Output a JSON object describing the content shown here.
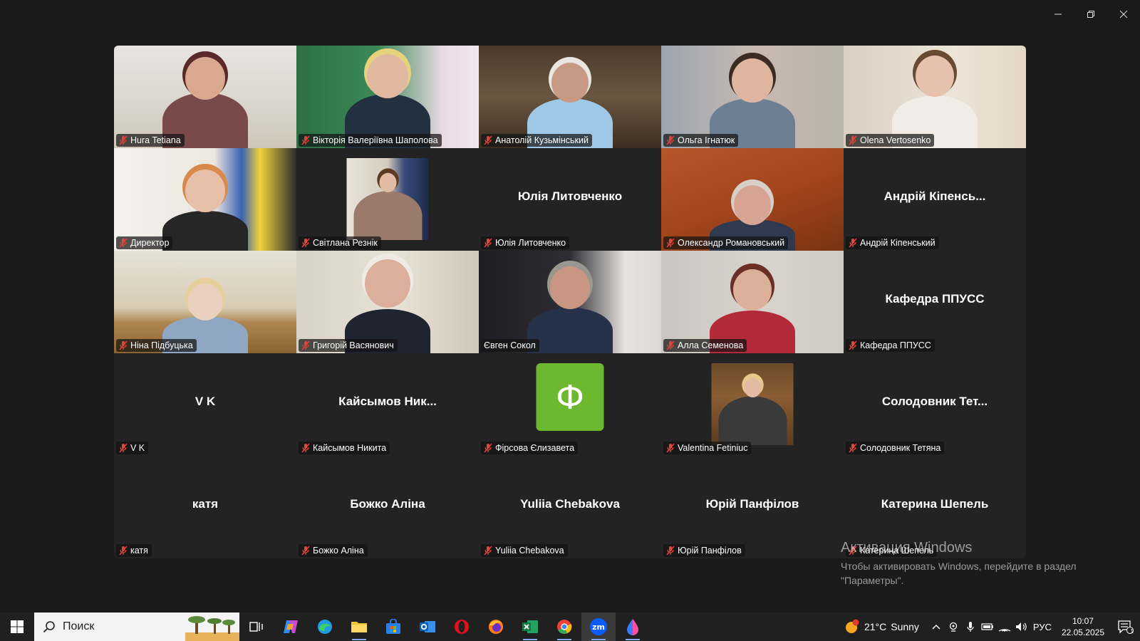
{
  "window_controls": {
    "minimize": "minimize",
    "restore": "restore",
    "close": "close"
  },
  "gallery": {
    "tiles": [
      {
        "name": "Hura Tetiana",
        "type": "video",
        "muted": true
      },
      {
        "name": "Вікторія Валеріївна Шаполова",
        "type": "video",
        "muted": true
      },
      {
        "name": "Анатолій Кузьмінський",
        "type": "video",
        "muted": true
      },
      {
        "name": "Ольга Ігнатюк",
        "type": "video",
        "muted": true
      },
      {
        "name": "Olena Vertosenko",
        "type": "video",
        "muted": true
      },
      {
        "name": "Директор",
        "type": "video",
        "muted": true
      },
      {
        "name": "Світлана Резнік",
        "type": "thumbnail",
        "muted": true
      },
      {
        "name": "Юлія Литовченко",
        "display": "Юлія Литовченко",
        "type": "name",
        "muted": true
      },
      {
        "name": "Олександр Романовський",
        "type": "video",
        "muted": true
      },
      {
        "name": "Андрій Кіпенський",
        "display": "Андрій Кіпенсь...",
        "type": "name",
        "muted": true
      },
      {
        "name": "Ніна Підбуцька",
        "type": "video",
        "muted": true
      },
      {
        "name": "Григорій Васянович",
        "type": "video",
        "muted": true
      },
      {
        "name": "Євген Сокол",
        "type": "video",
        "muted": false,
        "active": true
      },
      {
        "name": "Алла Семенова",
        "type": "video",
        "muted": true
      },
      {
        "name": "Кафедра ППУСС",
        "display": "Кафедра ППУСС",
        "type": "name",
        "muted": true
      },
      {
        "name": "V K",
        "display": "V K",
        "type": "name",
        "muted": true
      },
      {
        "name": "Кайсымов Никита",
        "display": "Кайсымов Ник...",
        "type": "name",
        "muted": true
      },
      {
        "name": "Фірсова Єлизавета",
        "avatar_letter": "Ф",
        "type": "avatar",
        "muted": true
      },
      {
        "name": "Valentina Fetiniuc",
        "type": "thumbnail",
        "muted": true
      },
      {
        "name": "Солодовник Тетяна",
        "display": "Солодовник Тет...",
        "type": "name",
        "muted": true
      },
      {
        "name": "катя",
        "display": "катя",
        "type": "name",
        "muted": true
      },
      {
        "name": "Божко Аліна",
        "display": "Божко Аліна",
        "type": "name",
        "muted": true
      },
      {
        "name": "Yuliia Chebakova",
        "display": "Yuliia Chebakova",
        "type": "name",
        "muted": true
      },
      {
        "name": "Юрій Панфілов",
        "display": "Юрій Панфілов",
        "type": "name",
        "muted": true
      },
      {
        "name": "Катерина Шепель",
        "display": "Катерина Шепель",
        "type": "name",
        "muted": true
      }
    ]
  },
  "watermark": {
    "title": "Активация Windows",
    "line1": "Чтобы активировать Windows, перейдите в раздел",
    "line2": "\"Параметры\"."
  },
  "taskbar": {
    "search_placeholder": "Поиск",
    "weather_temp": "21°C",
    "weather_text": "Sunny",
    "weather_badge": "1",
    "language": "РУС",
    "time": "10:07",
    "date": "22.05.2025",
    "notification_count": "1"
  },
  "colors": {
    "active_speaker": "#23d959",
    "muted_mic": "#e0453a",
    "avatar_bg": "#6cb82f"
  }
}
